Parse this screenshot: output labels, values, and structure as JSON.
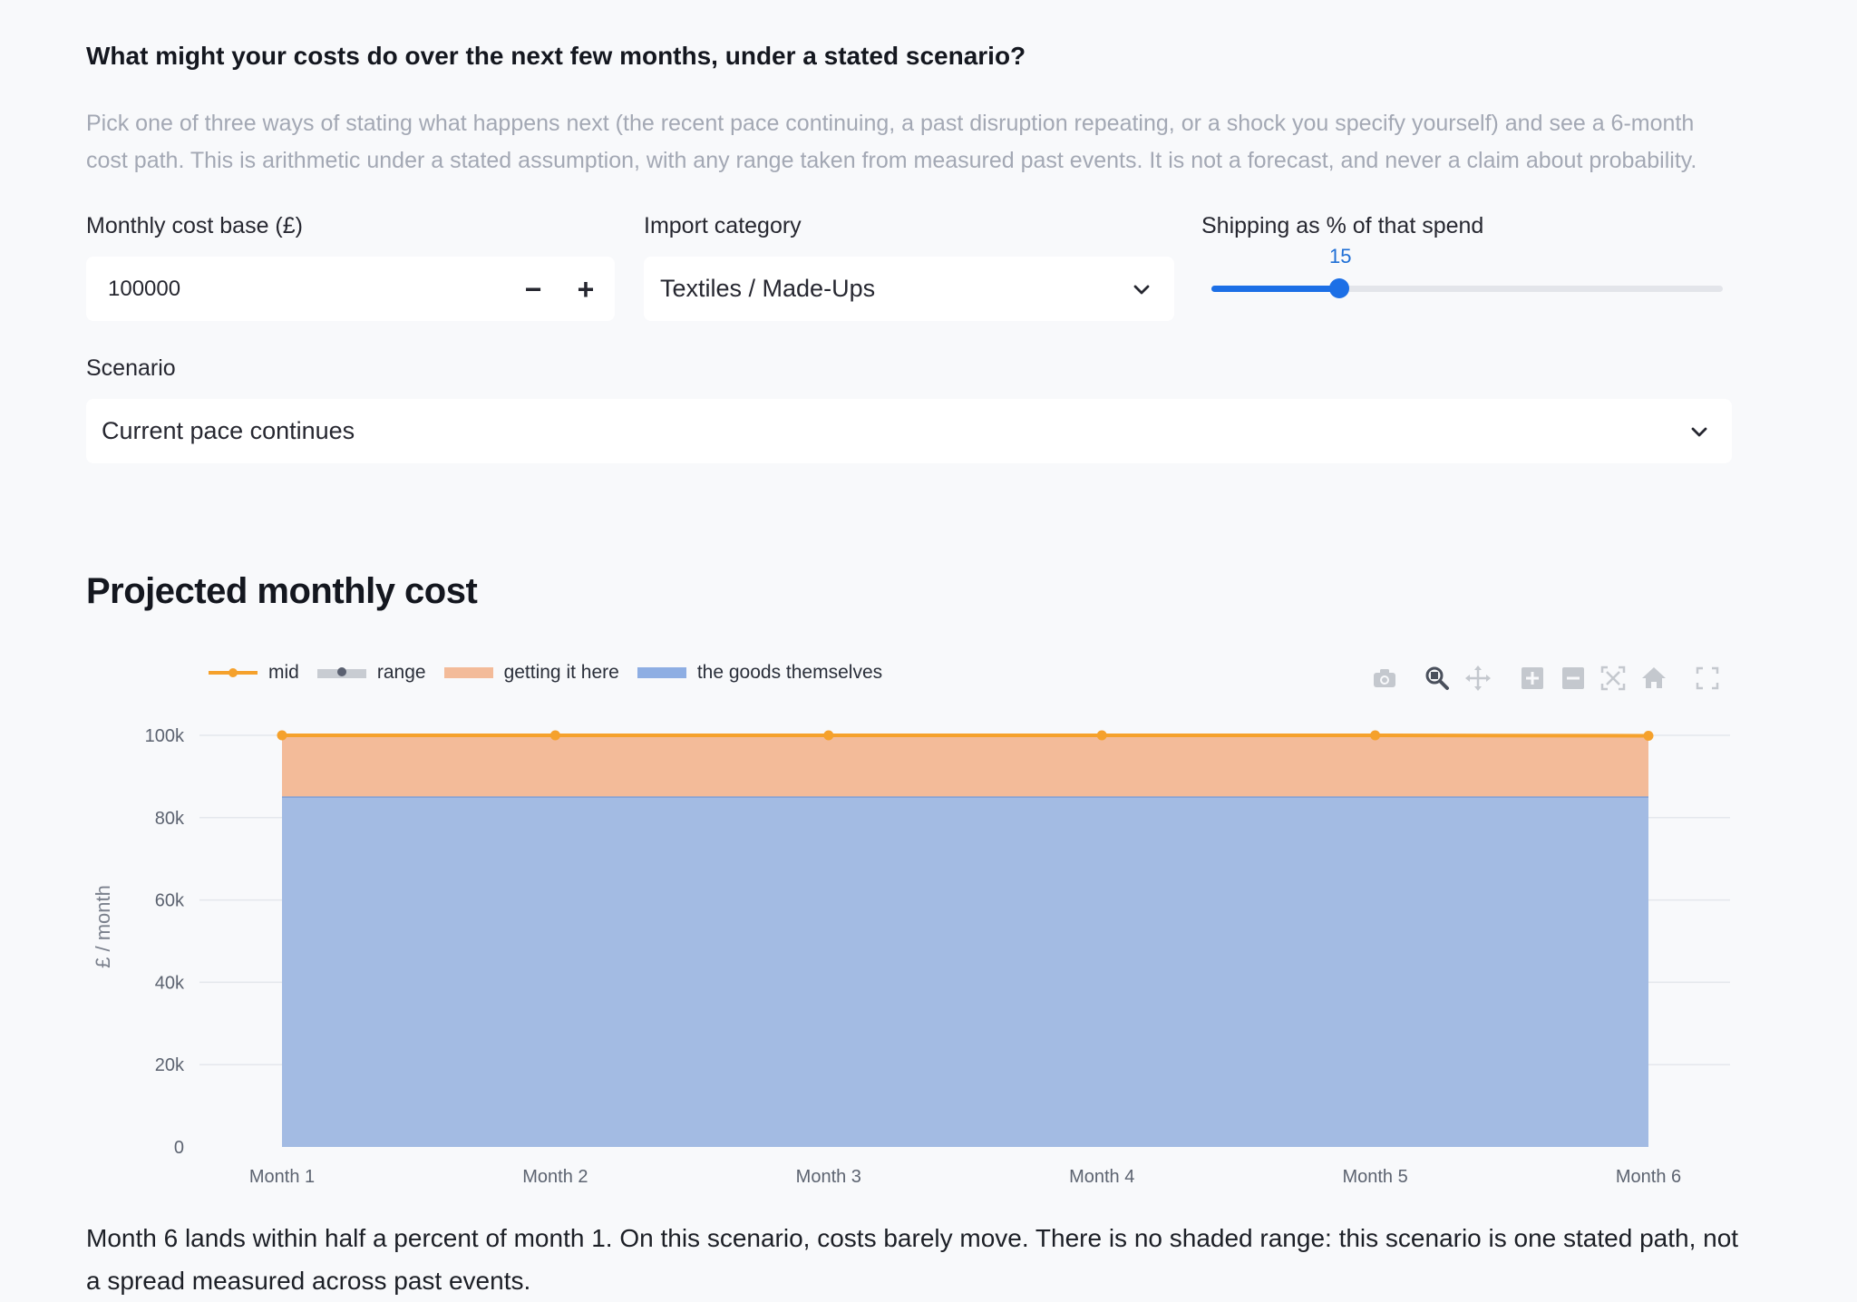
{
  "form": {
    "question": "What might your costs do over the next few months, under a stated scenario?",
    "intro": "Pick one of three ways of stating what happens next (the recent pace continuing, a past disruption repeating, or a shock you specify yourself) and see a 6-month cost path. This is arithmetic under a stated assumption, with any range taken from measured past events. It is not a forecast, and never a claim about probability.",
    "cost_base": {
      "label": "Monthly cost base (£)",
      "value": "100000",
      "minus": "−",
      "plus": "+"
    },
    "import_category": {
      "label": "Import category",
      "value": "Textiles / Made-Ups"
    },
    "shipping": {
      "label": "Shipping as % of that spend",
      "value": "15",
      "fraction": 0.25
    },
    "scenario": {
      "label": "Scenario",
      "value": "Current pace continues"
    }
  },
  "chart_section": {
    "title": "Projected monthly cost"
  },
  "modebar": [
    "camera-icon",
    "zoom-icon",
    "pan-icon",
    "zoom-in-icon",
    "zoom-out-icon",
    "autoscale-icon",
    "reset-axes-icon",
    "fullscreen-icon"
  ],
  "colors": {
    "mid": "#f5a12c",
    "range": "#c8ccd2",
    "getting_it_here": "#f3bb99",
    "goods": "#a3bbe3",
    "accent": "#1c6fe6"
  },
  "chart_data": {
    "type": "area",
    "categories": [
      "Month 1",
      "Month 2",
      "Month 3",
      "Month 4",
      "Month 5",
      "Month 6"
    ],
    "ylabel": "£ / month",
    "ylim": [
      0,
      100000
    ],
    "yticks": [
      0,
      20000,
      40000,
      60000,
      80000,
      100000
    ],
    "ytick_labels": [
      "0",
      "20k",
      "40k",
      "60k",
      "80k",
      "100k"
    ],
    "grid": true,
    "legend": [
      "mid",
      "range",
      "getting it here",
      "the goods themselves"
    ],
    "series": [
      {
        "name": "the goods themselves",
        "type": "area",
        "values": [
          85000,
          85000,
          85000,
          85000,
          85000,
          85000
        ]
      },
      {
        "name": "getting it here",
        "type": "area",
        "values": [
          15000,
          15000,
          15000,
          15000,
          15000,
          15000
        ]
      },
      {
        "name": "mid",
        "type": "line",
        "values": [
          100000,
          100000,
          100000,
          100000,
          100000,
          99900
        ]
      }
    ]
  },
  "footnote": "Month 6 lands within half a percent of month 1. On this scenario, costs barely move. There is no shaded range: this scenario is one stated path, not a spread measured across past events."
}
